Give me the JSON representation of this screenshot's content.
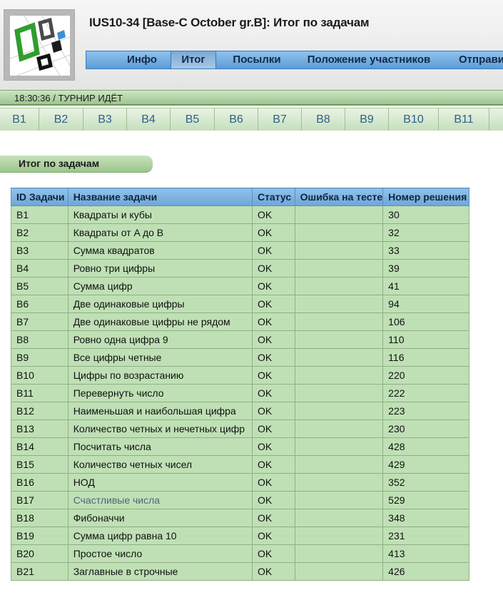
{
  "header": {
    "title": "IUS10-34 [Base-C October gr.B]: Итог по задачам"
  },
  "menu": [
    {
      "label": "Инфо",
      "active": false
    },
    {
      "label": "Итог",
      "active": true
    },
    {
      "label": "Посылки",
      "active": false
    },
    {
      "label": "Положение участников",
      "active": false
    },
    {
      "label": "Отправит",
      "active": false
    }
  ],
  "status": {
    "time": "18:30:36 / ",
    "state": "ТУРНИР ИДЁТ"
  },
  "tabs": [
    "B1",
    "B2",
    "B3",
    "B4",
    "B5",
    "B6",
    "B7",
    "B8",
    "B9",
    "B10",
    "B11"
  ],
  "section_heading": "Итог по задачам",
  "table": {
    "headers": [
      "ID Задачи",
      "Название задачи",
      "Статус",
      "Ошибка на тесте",
      "Номер решения"
    ],
    "rows": [
      {
        "id": "B1",
        "name": "Квадраты и кубы",
        "status": "OK",
        "error": "",
        "num": "30"
      },
      {
        "id": "B2",
        "name": "Квадраты от A до B",
        "status": "OK",
        "error": "",
        "num": "32"
      },
      {
        "id": "B3",
        "name": "Сумма квадратов",
        "status": "OK",
        "error": "",
        "num": "33"
      },
      {
        "id": "B4",
        "name": "Ровно три цифры",
        "status": "OK",
        "error": "",
        "num": "39"
      },
      {
        "id": "B5",
        "name": "Сумма цифр",
        "status": "OK",
        "error": "",
        "num": "41"
      },
      {
        "id": "B6",
        "name": "Две одинаковые цифры",
        "status": "OK",
        "error": "",
        "num": "94"
      },
      {
        "id": "B7",
        "name": "Две одинаковые цифры не рядом",
        "status": "OK",
        "error": "",
        "num": "106"
      },
      {
        "id": "B8",
        "name": "Ровно одна цифра 9",
        "status": "OK",
        "error": "",
        "num": "110"
      },
      {
        "id": "B9",
        "name": "Все цифры четные",
        "status": "OK",
        "error": "",
        "num": "116"
      },
      {
        "id": "B10",
        "name": "Цифры по возрастанию",
        "status": "OK",
        "error": "",
        "num": "220"
      },
      {
        "id": "B11",
        "name": "Перевернуть число",
        "status": "OK",
        "error": "",
        "num": "222"
      },
      {
        "id": "B12",
        "name": "Наименьшая и наибольшая цифра",
        "status": "OK",
        "error": "",
        "num": "223"
      },
      {
        "id": "B13",
        "name": "Количество четных и нечетных цифр",
        "status": "OK",
        "error": "",
        "num": "230"
      },
      {
        "id": "B14",
        "name": "Посчитать числа",
        "status": "OK",
        "error": "",
        "num": "428"
      },
      {
        "id": "B15",
        "name": "Количество четных чисел",
        "status": "OK",
        "error": "",
        "num": "429"
      },
      {
        "id": "B16",
        "name": "НОД",
        "status": "OK",
        "error": "",
        "num": "352"
      },
      {
        "id": "B17",
        "name": "Счастливые числа",
        "status": "OK",
        "error": "",
        "num": "529",
        "link": true
      },
      {
        "id": "B18",
        "name": "Фибоначчи",
        "status": "OK",
        "error": "",
        "num": "348"
      },
      {
        "id": "B19",
        "name": "Сумма цифр равна 10",
        "status": "OK",
        "error": "",
        "num": "231"
      },
      {
        "id": "B20",
        "name": "Простое число",
        "status": "OK",
        "error": "",
        "num": "413"
      },
      {
        "id": "B21",
        "name": "Заглавные в строчные",
        "status": "OK",
        "error": "",
        "num": "426"
      }
    ]
  },
  "colors": {
    "menu_blue": "#6fa6d8",
    "row_green": "#bfe0b5",
    "bar_green": "#9dc58e"
  },
  "logo_icon": "logo-icon"
}
